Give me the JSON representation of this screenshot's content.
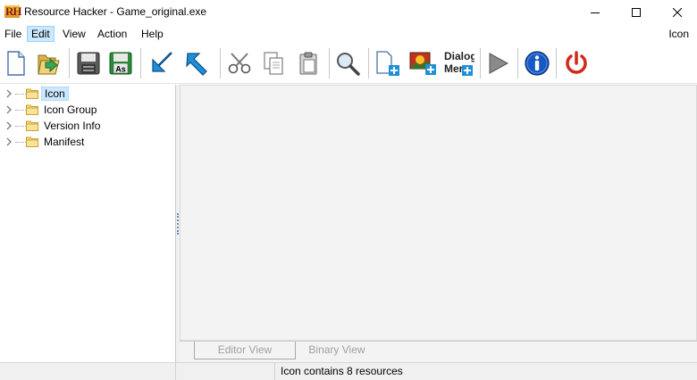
{
  "window": {
    "logo_text": "RH",
    "title": "Resource Hacker - Game_original.exe"
  },
  "menu": {
    "items": [
      "File",
      "Edit",
      "View",
      "Action",
      "Help"
    ],
    "active": "Edit",
    "right_label": "Icon"
  },
  "toolbar": {
    "buttons": [
      {
        "icon": "new-file-icon"
      },
      {
        "icon": "open-folder-icon"
      },
      {
        "icon": "save-icon"
      },
      {
        "icon": "save-as-icon",
        "label": "As"
      },
      {
        "icon": "compile-arrow-icon"
      },
      {
        "icon": "export-arrow-icon"
      },
      {
        "icon": "scissors-icon"
      },
      {
        "icon": "copy-icon"
      },
      {
        "icon": "paste-icon"
      },
      {
        "icon": "magnifier-icon"
      },
      {
        "icon": "add-blank-resource-icon"
      },
      {
        "icon": "add-image-resource-icon"
      },
      {
        "icon": "dialog-menu-icon",
        "label_line1": "Dialog",
        "label_line2": "Mer"
      },
      {
        "icon": "run-play-icon"
      },
      {
        "icon": "info-icon"
      },
      {
        "icon": "power-icon"
      }
    ]
  },
  "tree": {
    "items": [
      {
        "label": "Icon",
        "selected": true
      },
      {
        "label": "Icon Group",
        "selected": false
      },
      {
        "label": "Version Info",
        "selected": false
      },
      {
        "label": "Manifest",
        "selected": false
      }
    ]
  },
  "tabs": {
    "editor": "Editor View",
    "binary": "Binary View"
  },
  "status": {
    "text": "Icon contains 8 resources"
  },
  "colors": {
    "selection_bg": "#cce8ff",
    "selection_border": "#99d1ff",
    "toolbar_blue": "#1f8fd8",
    "info_blue": "#1658c4",
    "power_red": "#d12a1a"
  }
}
